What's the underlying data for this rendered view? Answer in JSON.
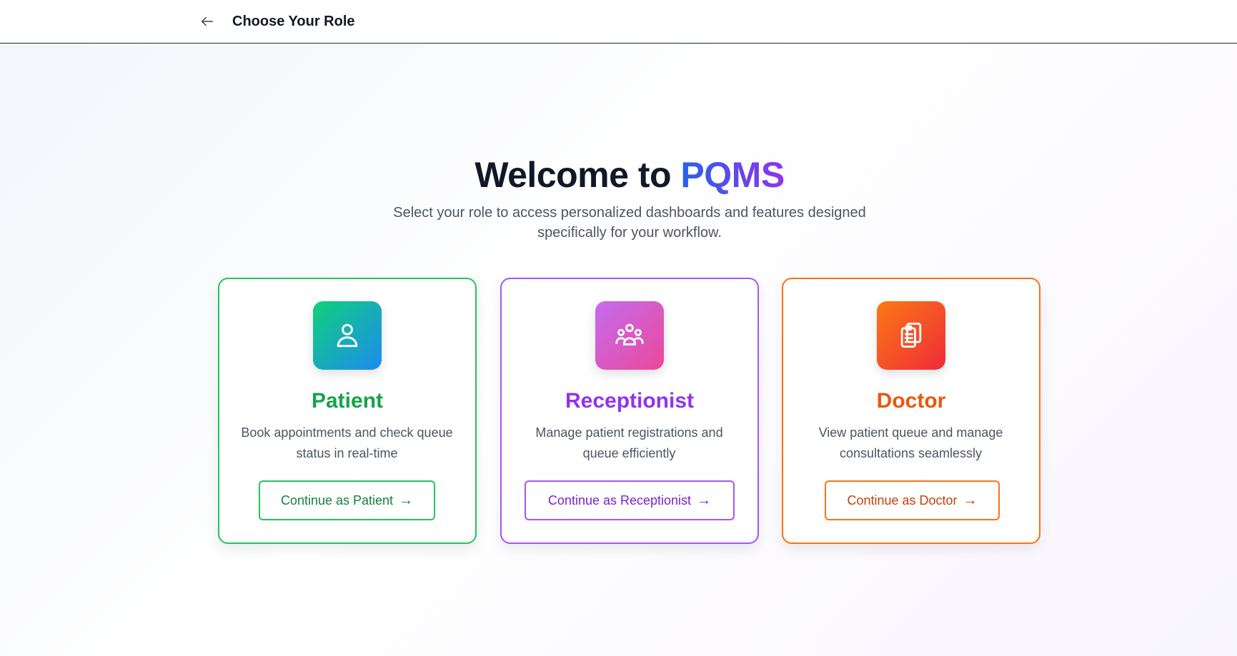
{
  "header": {
    "title": "Choose Your Role",
    "back_icon": "arrow-left-icon"
  },
  "hero": {
    "title_prefix": "Welcome to ",
    "title_brand": "PQMS",
    "subtitle": "Select your role to access personalized dashboards and features designed specifically for your workflow."
  },
  "roles": [
    {
      "icon": "user-icon",
      "title": "Patient",
      "description": "Book appointments and check queue status in real-time",
      "button_label": "Continue as Patient",
      "arrow": "→",
      "accent": "#16a34a"
    },
    {
      "icon": "users-group-icon",
      "title": "Receptionist",
      "description": "Manage patient registrations and queue efficiently",
      "button_label": "Continue as Receptionist",
      "arrow": "→",
      "accent": "#9333ea"
    },
    {
      "icon": "clipboard-icon",
      "title": "Doctor",
      "description": "View patient queue and manage consultations seamlessly",
      "button_label": "Continue as Doctor",
      "arrow": "→",
      "accent": "#ea580c"
    }
  ]
}
